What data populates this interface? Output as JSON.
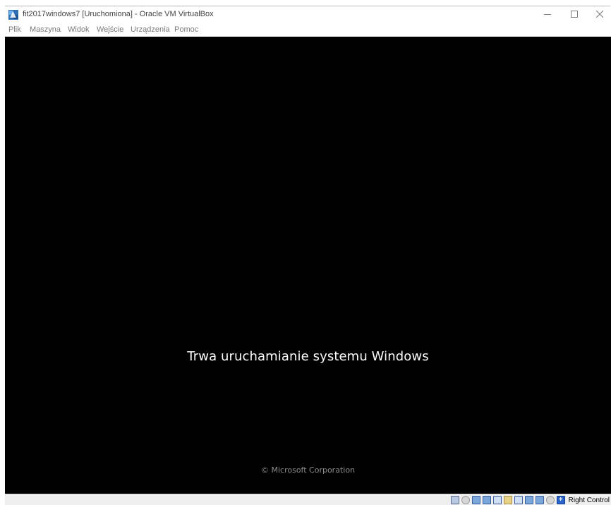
{
  "window": {
    "title": "fit2017windows7 [Uruchomiona] - Oracle VM VirtualBox",
    "app_icon": "virtualbox-icon",
    "controls": {
      "minimize_icon": "minimize-icon",
      "maximize_icon": "maximize-icon",
      "close_icon": "close-icon"
    }
  },
  "menubar": {
    "items": [
      {
        "label": "Plik"
      },
      {
        "label": "Maszyna"
      },
      {
        "label": "Widok"
      },
      {
        "label": "Wejście"
      },
      {
        "label": "Urządzenia"
      },
      {
        "label": "Pomoc"
      }
    ]
  },
  "vm_screen": {
    "boot_message": "Trwa uruchamianie systemu Windows",
    "copyright": "© Microsoft Corporation"
  },
  "statusbar": {
    "icons": [
      "hard-disk-icon",
      "optical-drive-icon",
      "audio-icon",
      "network-icon",
      "usb-icon",
      "shared-folders-icon",
      "display-icon",
      "video-capture-icon",
      "virtualization-icon",
      "mouse-integration-icon",
      "keyboard-icon"
    ],
    "host_key": "Right Control"
  },
  "colors": {
    "vm_background": "#000000",
    "boot_text": "#ffffff",
    "copyright_text": "#8c8c8c",
    "titlebar": "#ffffff",
    "statusbar": "#efefef"
  }
}
